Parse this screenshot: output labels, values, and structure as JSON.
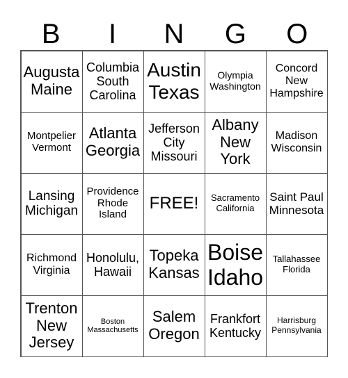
{
  "header": [
    "B",
    "I",
    "N",
    "G",
    "O"
  ],
  "cells": [
    {
      "text": "Augusta\nMaine",
      "size": 22
    },
    {
      "text": "Columbia\nSouth\nCarolina",
      "size": 18
    },
    {
      "text": "Austin\nTexas",
      "size": 28
    },
    {
      "text": "Olympia\nWashington",
      "size": 14
    },
    {
      "text": "Concord\nNew\nHampshire",
      "size": 16
    },
    {
      "text": "Montpelier\nVermont",
      "size": 15
    },
    {
      "text": "Atlanta\nGeorgia",
      "size": 22
    },
    {
      "text": "Jefferson\nCity\nMissouri",
      "size": 18
    },
    {
      "text": "Albany\nNew\nYork",
      "size": 22
    },
    {
      "text": "Madison\nWisconsin",
      "size": 16
    },
    {
      "text": "Lansing\nMichigan",
      "size": 19
    },
    {
      "text": "Providence\nRhode\nIsland",
      "size": 15
    },
    {
      "text": "FREE!",
      "size": 24
    },
    {
      "text": "Sacramento\nCalifornia",
      "size": 13
    },
    {
      "text": "Saint Paul\nMinnesota",
      "size": 17
    },
    {
      "text": "Richmond\nVirginia",
      "size": 16
    },
    {
      "text": "Honolulu,\nHawaii",
      "size": 18
    },
    {
      "text": "Topeka\nKansas",
      "size": 22
    },
    {
      "text": "Boise\nIdaho",
      "size": 32
    },
    {
      "text": "Tallahassee\nFlorida",
      "size": 13
    },
    {
      "text": "Trenton\nNew\nJersey",
      "size": 22
    },
    {
      "text": "Boston\nMassachusetts",
      "size": 11
    },
    {
      "text": "Salem\nOregon",
      "size": 22
    },
    {
      "text": "Frankfort\nKentucky",
      "size": 18
    },
    {
      "text": "Harrisburg\nPennsylvania",
      "size": 12
    }
  ]
}
